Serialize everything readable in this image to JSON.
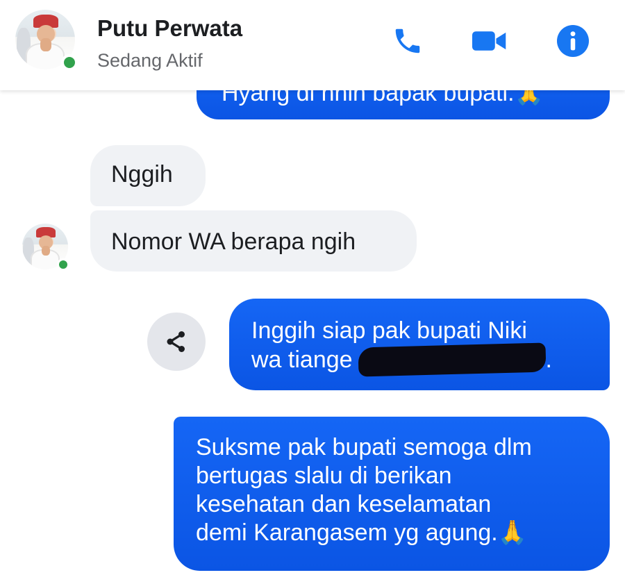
{
  "header": {
    "contact_name": "Putu Perwata",
    "status": "Sedang Aktif",
    "actions": {
      "call": "phone-icon",
      "video": "video-camera-icon",
      "info": "info-icon"
    }
  },
  "messages": [
    {
      "id": "m1",
      "direction": "out",
      "text": "Hyang di nhih bapak bupati.🙏",
      "partially_visible": true
    },
    {
      "id": "m2",
      "direction": "in",
      "text": "Nggih"
    },
    {
      "id": "m3",
      "direction": "in",
      "text": "Nomor WA berapa ngih"
    },
    {
      "id": "m4",
      "direction": "out",
      "line1": "Inggih siap pak bupati Niki",
      "line2_prefix": "wa tiange",
      "line2_suffix": ".",
      "redacted": true
    },
    {
      "id": "m5",
      "direction": "out",
      "lines": [
        "Suksme pak bupati semoga dlm",
        "bertugas slalu di berikan",
        "kesehatan dan keselamatan",
        "demi Karangasem yg agung.🙏"
      ]
    }
  ],
  "colors": {
    "outgoing_bubble": "#0b5ff0",
    "incoming_bubble": "#f0f2f5",
    "accent": "#1877f2",
    "online": "#31a24c"
  }
}
